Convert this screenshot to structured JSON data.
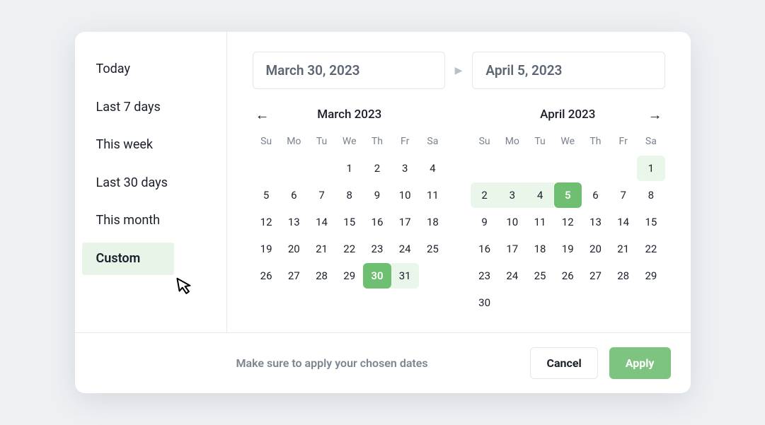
{
  "presets": [
    {
      "label": "Today",
      "active": false
    },
    {
      "label": "Last 7 days",
      "active": false
    },
    {
      "label": "This week",
      "active": false
    },
    {
      "label": "Last 30 days",
      "active": false
    },
    {
      "label": "This month",
      "active": false
    },
    {
      "label": "Custom",
      "active": true
    }
  ],
  "start_input": "March 30, 2023",
  "end_input": "April 5, 2023",
  "dows": [
    "Su",
    "Mo",
    "Tu",
    "We",
    "Th",
    "Fr",
    "Sa"
  ],
  "months": [
    {
      "title": "March 2023",
      "leading_blanks": 3,
      "days": 31,
      "selected": [
        30
      ],
      "range": [
        30,
        31
      ]
    },
    {
      "title": "April 2023",
      "leading_blanks": 6,
      "days": 30,
      "selected": [
        5
      ],
      "range": [
        1,
        5
      ]
    }
  ],
  "footer_hint": "Make sure to apply your chosen dates",
  "cancel_label": "Cancel",
  "apply_label": "Apply"
}
